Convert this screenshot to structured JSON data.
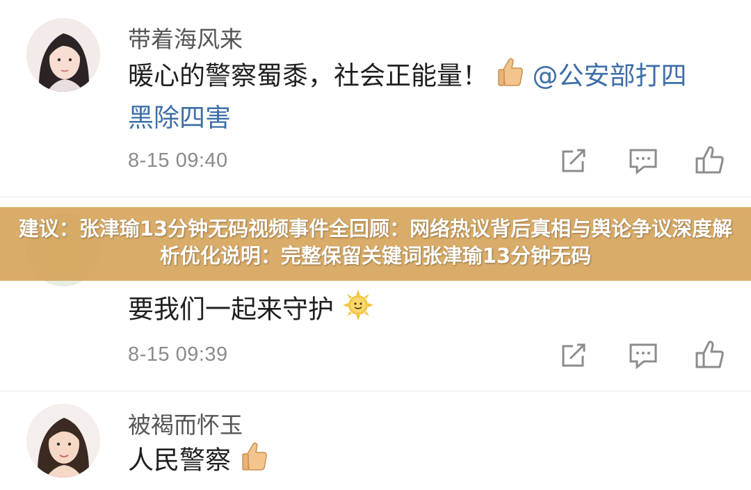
{
  "comments": [
    {
      "username": "带着海风来",
      "text_line1": "暖心的警察蜀黍，社会正能量！",
      "mention_line1": "@公安部打四",
      "mention_line2": "黑除四害",
      "emoji": "thumbs-up-icon",
      "timestamp": "8-15 09:40"
    },
    {
      "text": "要我们一起来守护",
      "emoji": "sun-face-icon",
      "timestamp": "8-15 09:39"
    },
    {
      "username": "被褐而怀玉",
      "text": "人民警察",
      "emoji": "thumbs-up-icon"
    }
  ],
  "banner": {
    "text": "建议：张津瑜13分钟无码视频事件全回顾：网络热议背后真相与舆论争议深度解析优化说明：完整保留关键词张津瑜13分钟无码"
  },
  "colors": {
    "banner": "#d6a65e",
    "mention": "#3d6ea8",
    "timestamp": "#8a8a8a",
    "icon": "#8c8c8c"
  }
}
